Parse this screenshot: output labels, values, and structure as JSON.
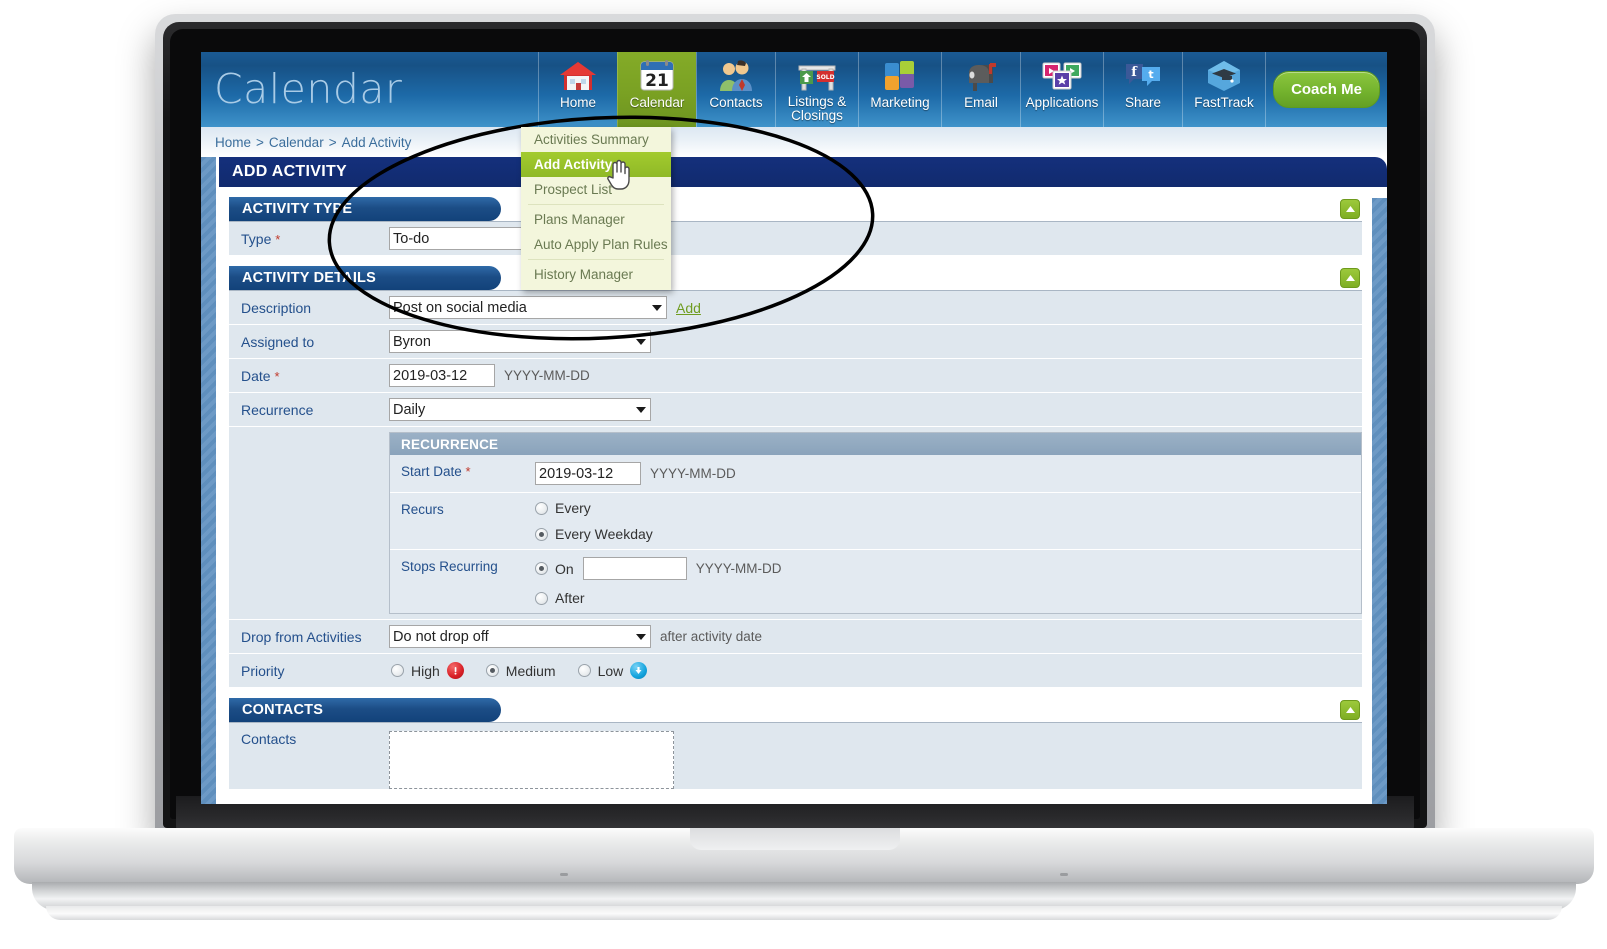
{
  "app": {
    "brand": "Calendar"
  },
  "nav": {
    "items": [
      {
        "label": "Home",
        "icon": "house-icon",
        "active": false
      },
      {
        "label": "Calendar",
        "icon": "calendar-icon",
        "active": true
      },
      {
        "label": "Contacts",
        "icon": "people-icon",
        "active": false
      },
      {
        "label": "Listings & Closings",
        "icon": "sold-sign-icon",
        "active": false
      },
      {
        "label": "Marketing",
        "icon": "puzzle-icon",
        "active": false
      },
      {
        "label": "Email",
        "icon": "mailbox-icon",
        "active": false
      },
      {
        "label": "Applications",
        "icon": "app-tiles-icon",
        "active": false
      },
      {
        "label": "Share",
        "icon": "social-icon",
        "active": false
      },
      {
        "label": "FastTrack",
        "icon": "graduation-cap-icon",
        "active": false
      }
    ],
    "coach_me": "Coach Me"
  },
  "breadcrumb": {
    "items": [
      "Home",
      "Calendar",
      "Add Activity"
    ],
    "separator": ">"
  },
  "dropdown_menu": {
    "items": [
      {
        "label": "Activities Summary",
        "selected": false
      },
      {
        "label": "Add Activity",
        "selected": true
      },
      {
        "label": "Prospect List",
        "selected": false
      },
      {
        "label": "Plans Manager",
        "selected": false
      },
      {
        "label": "Auto Apply Plan Rules",
        "selected": false
      },
      {
        "label": "History Manager",
        "selected": false
      }
    ]
  },
  "page": {
    "title": "ADD ACTIVITY"
  },
  "activity_type": {
    "heading": "ACTIVITY TYPE",
    "type_label": "Type",
    "type_required": "*",
    "type_value": "To-do"
  },
  "activity_details": {
    "heading": "ACTIVITY DETAILS",
    "description_label": "Description",
    "description_value": "Post on social media",
    "add_link": "Add",
    "assigned_label": "Assigned to",
    "assigned_value": "Byron",
    "date_label": "Date",
    "date_required": "*",
    "date_value": "2019-03-12",
    "date_hint": "YYYY-MM-DD",
    "recurrence_label": "Recurrence",
    "recurrence_value": "Daily",
    "drop_label": "Drop from Activities",
    "drop_value": "Do not drop off",
    "drop_hint": "after activity date",
    "priority_label": "Priority",
    "priority_options": [
      {
        "label": "High",
        "selected": false,
        "icon": "exclamation-icon"
      },
      {
        "label": "Medium",
        "selected": true,
        "icon": "none"
      },
      {
        "label": "Low",
        "selected": false,
        "icon": "down-arrow-icon"
      }
    ]
  },
  "recurrence_panel": {
    "heading": "RECURRENCE",
    "start_date_label": "Start Date",
    "start_date_required": "*",
    "start_date_value": "2019-03-12",
    "start_date_hint": "YYYY-MM-DD",
    "recurs_label": "Recurs",
    "recurs_options": [
      {
        "label": "Every",
        "selected": false
      },
      {
        "label": "Every Weekday",
        "selected": true
      }
    ],
    "stops_label": "Stops Recurring",
    "stops_on_label": "On",
    "stops_on_selected": true,
    "stops_on_value": "",
    "stops_on_hint": "YYYY-MM-DD",
    "stops_after_label": "After",
    "stops_after_selected": false
  },
  "contacts": {
    "heading": "CONTACTS",
    "label": "Contacts",
    "value": ""
  },
  "colors": {
    "header_blue": "#1d6aa8",
    "nav_active_green": "#7aa123",
    "title_navy": "#14307c",
    "panel_blue": "#1c4d86",
    "accent_green": "#8fb927",
    "coach_green": "#74b32e",
    "row_bg": "#dfe7ee",
    "label_blue": "#24508c",
    "required_red": "#c0392b",
    "priority_high_red": "#d81f26",
    "priority_low_blue": "#13a3dd",
    "subpanel_header": "#8aa3bb",
    "annotation_black": "#000000"
  },
  "annotation": {
    "shape": "ellipse",
    "description": "hand-drawn black ellipse highlighting the Recurrence panel"
  }
}
